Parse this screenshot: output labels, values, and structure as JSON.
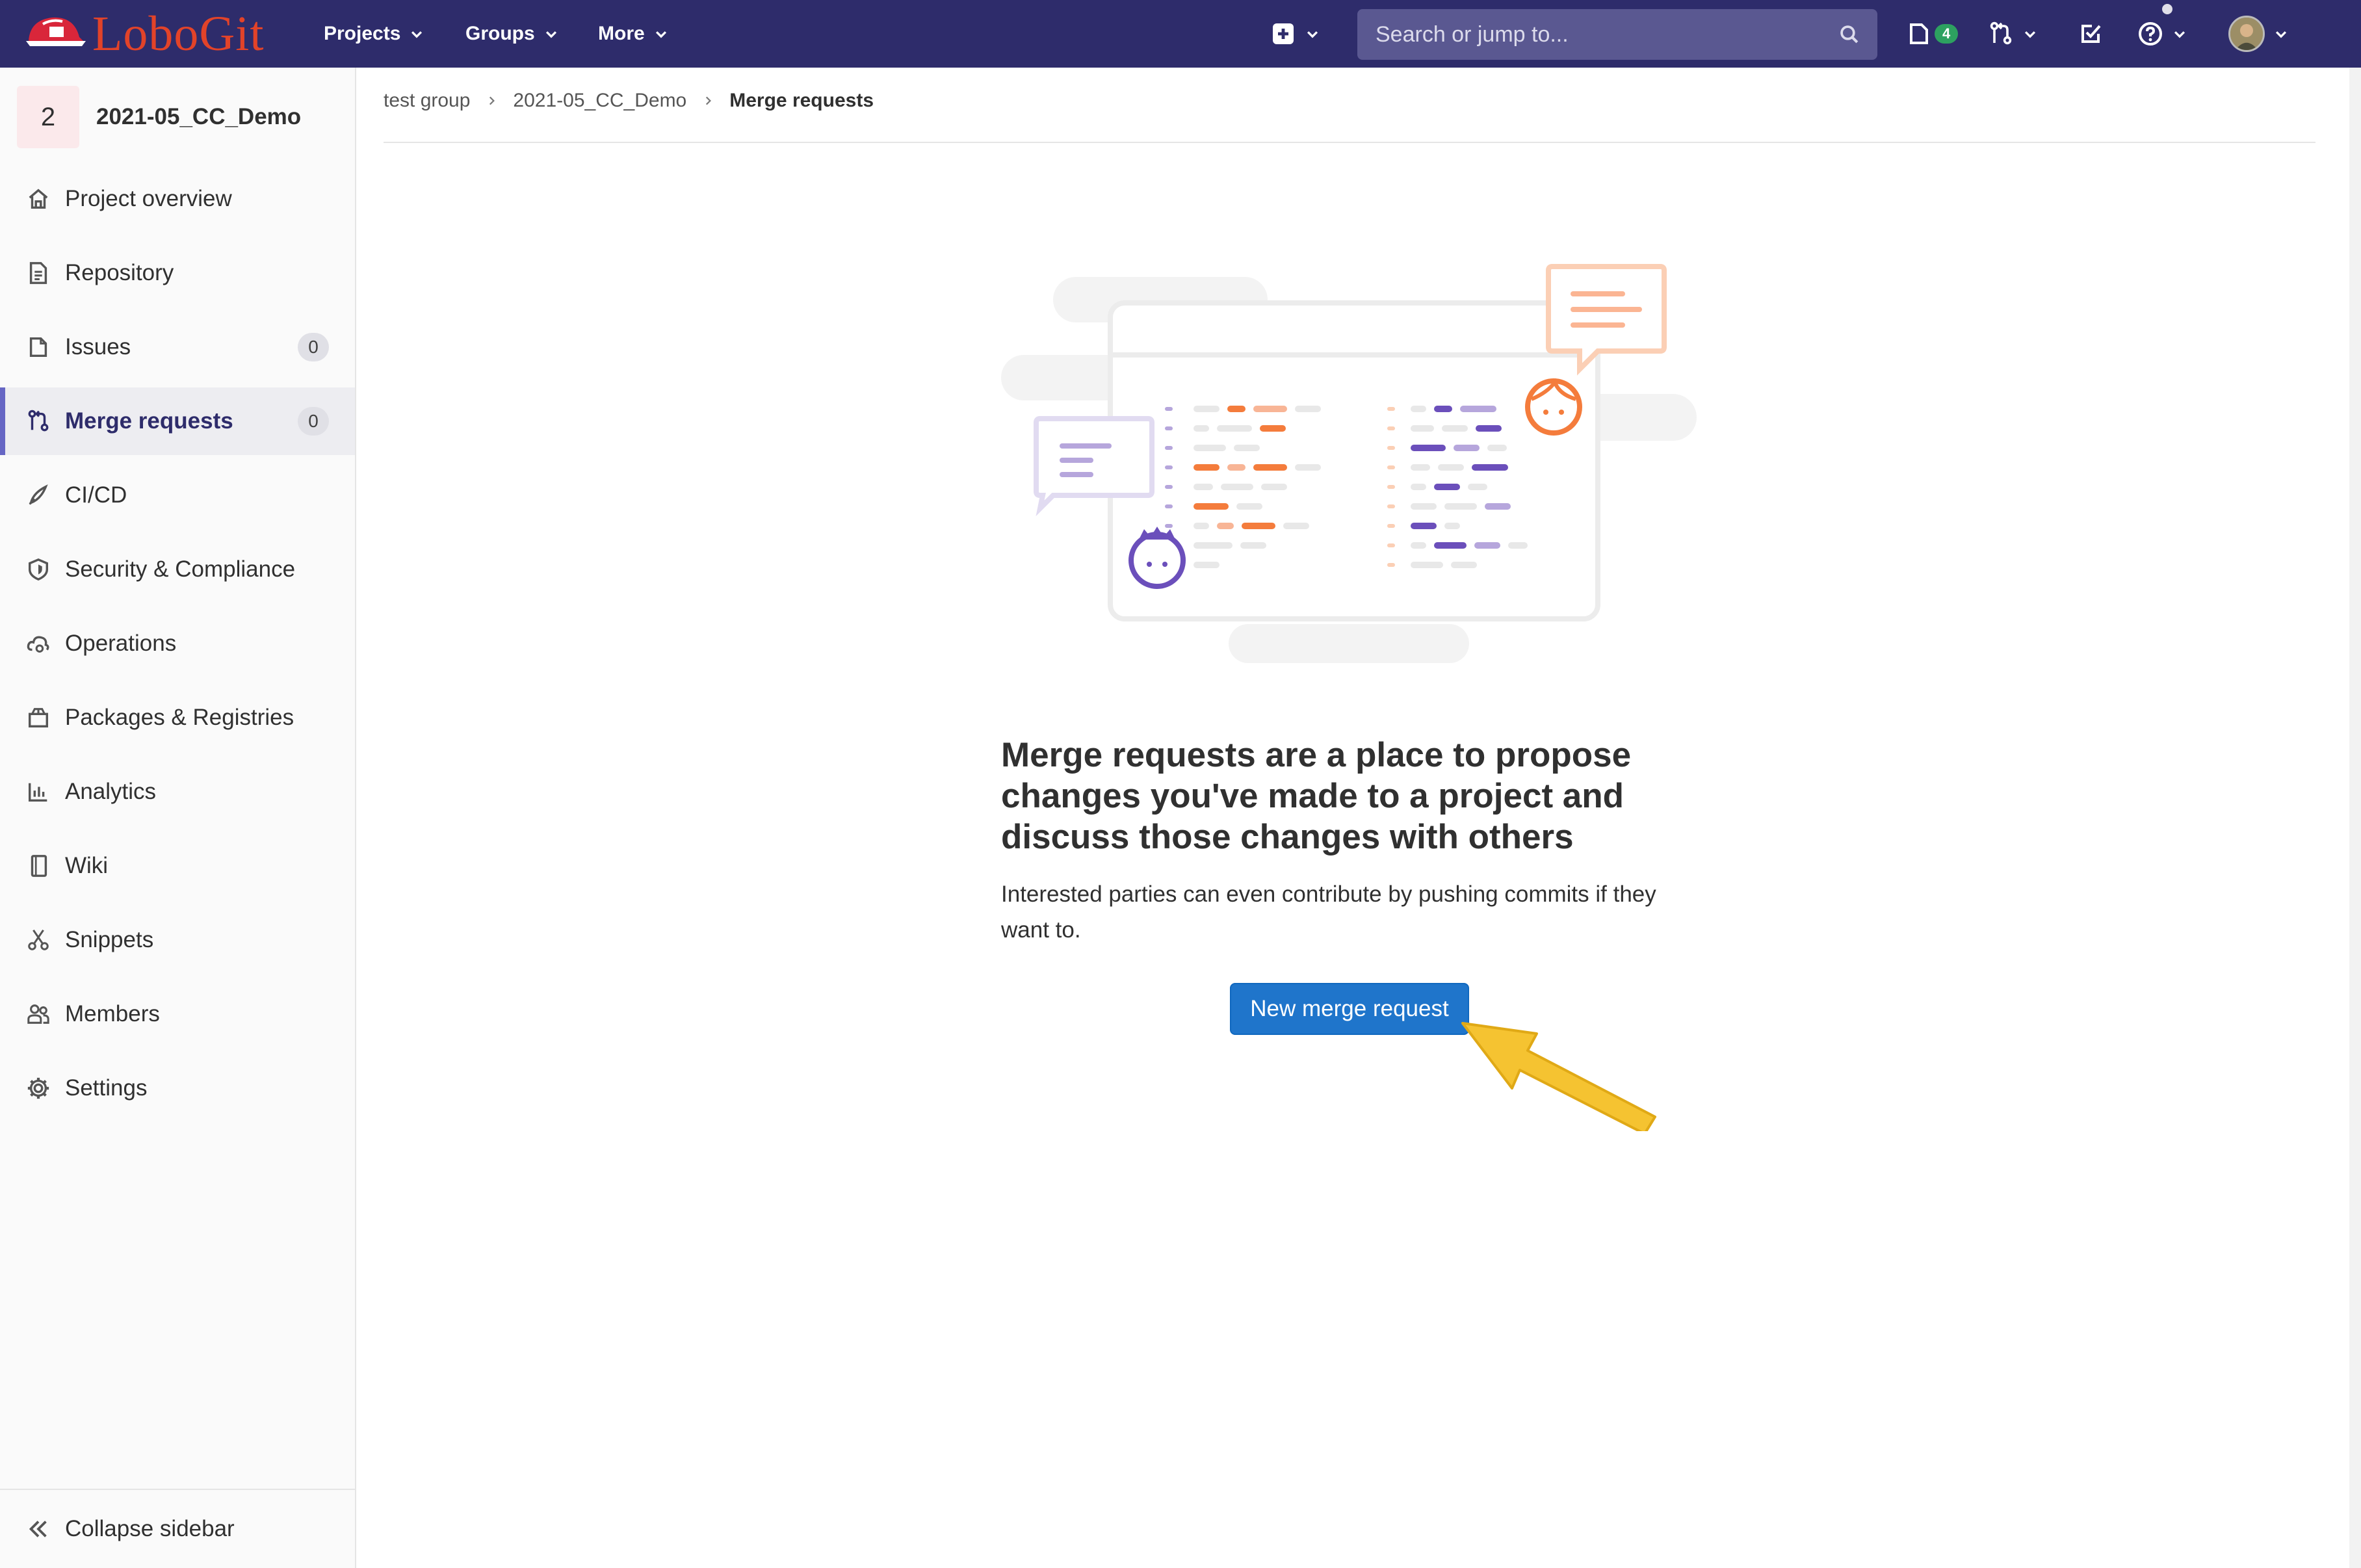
{
  "brand": {
    "name": "LoboGit"
  },
  "topnav": {
    "menus": [
      "Projects",
      "Groups",
      "More"
    ],
    "search_placeholder": "Search or jump to...",
    "issues_count": "4"
  },
  "project": {
    "avatar_letter": "2",
    "name": "2021-05_CC_Demo"
  },
  "sidebar": {
    "items": [
      {
        "label": "Project overview",
        "icon": "home-icon"
      },
      {
        "label": "Repository",
        "icon": "doc-icon"
      },
      {
        "label": "Issues",
        "icon": "issues-icon",
        "count": "0"
      },
      {
        "label": "Merge requests",
        "icon": "merge-request-icon",
        "count": "0",
        "active": true
      },
      {
        "label": "CI/CD",
        "icon": "rocket-icon"
      },
      {
        "label": "Security & Compliance",
        "icon": "shield-icon"
      },
      {
        "label": "Operations",
        "icon": "cloud-gear-icon"
      },
      {
        "label": "Packages & Registries",
        "icon": "package-icon"
      },
      {
        "label": "Analytics",
        "icon": "chart-icon"
      },
      {
        "label": "Wiki",
        "icon": "book-icon"
      },
      {
        "label": "Snippets",
        "icon": "scissors-icon"
      },
      {
        "label": "Members",
        "icon": "users-icon"
      },
      {
        "label": "Settings",
        "icon": "gear-icon"
      }
    ],
    "collapse_label": "Collapse sidebar"
  },
  "breadcrumb": [
    "test group",
    "2021-05_CC_Demo",
    "Merge requests"
  ],
  "empty_state": {
    "title": "Merge requests are a place to propose changes you've made to a project and discuss those changes with others",
    "description": "Interested parties can even contribute by pushing commits if they want to.",
    "button_label": "New merge request"
  },
  "colors": {
    "navbar": "#2e2c6b",
    "brand_orange": "#e24329",
    "primary_button": "#1f75cb",
    "annotation_arrow": "#f5c331"
  }
}
